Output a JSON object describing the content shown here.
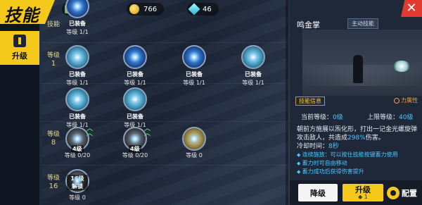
{
  "header": {
    "title": "技能",
    "currencies": [
      {
        "icon": "coin-icon",
        "value": "766"
      },
      {
        "icon": "gem-icon",
        "value": "46"
      }
    ]
  },
  "sidebar": {
    "tabs": [
      {
        "label": "升级",
        "icon": "upgrade-tab-icon",
        "active": true
      }
    ]
  },
  "rows": [
    {
      "label": "技能",
      "level": ""
    },
    {
      "label": "等级",
      "level": "1"
    },
    {
      "label": "",
      "level": ""
    },
    {
      "label": "等级",
      "level": "8"
    },
    {
      "label": "等级",
      "level": "16"
    }
  ],
  "skills": [
    {
      "status": "已装备",
      "level": "等级 1/1",
      "color": "blue"
    },
    {
      "status": "已装备",
      "level": "等级 1/1",
      "color": "cyan"
    },
    {
      "status": "已装备",
      "level": "等级 1/1",
      "color": "blue"
    },
    {
      "status": "已装备",
      "level": "等级 1/1",
      "color": "blue"
    },
    {
      "status": "已装备",
      "level": "等级 1/1",
      "color": "cyan"
    },
    {
      "status": "已装备",
      "level": "等级 1/1",
      "color": "cyan"
    },
    {
      "status": "已装备",
      "level": "等级 1/1",
      "color": "cyan"
    },
    {
      "status": "",
      "level": "等级 0/20",
      "badge": "4级",
      "color": "dark"
    },
    {
      "status": "",
      "level": "等级 0/20",
      "badge": "4级",
      "color": "dark"
    },
    {
      "status": "",
      "level": "等级 0",
      "badge": "",
      "color": "gold"
    },
    {
      "status": "",
      "level": "等级 0",
      "badge": "16级解锁",
      "color": "dark"
    }
  ],
  "panel": {
    "skill_name": "鸣金掌",
    "skill_type": "主动技能",
    "info_title": "技能信息",
    "attribute": "力属性",
    "current_level_label": "当前等级：",
    "current_level": "0级",
    "max_level_label": "上限等级：",
    "max_level": "40级",
    "desc_part1": "朝前方施展以炁化形，打出一记金光螺旋弹攻击敌人，共造成",
    "desc_pct": "298%",
    "desc_part2": "伤害。",
    "cd_label": "冷却时间：",
    "cd_value": "8秒",
    "bullets": [
      "连续施放：可以按住技能按键蓄力使用",
      "蓄力时可自由移动",
      "蓄力成功后获得伤害提升"
    ],
    "buttons": {
      "downgrade": "降级",
      "upgrade": "升级",
      "upgrade_cost": "1",
      "config": "配置"
    }
  },
  "colors": {
    "accent": "#f5c91b",
    "highlight": "#4cc6ff",
    "close": "#e23a2f"
  }
}
